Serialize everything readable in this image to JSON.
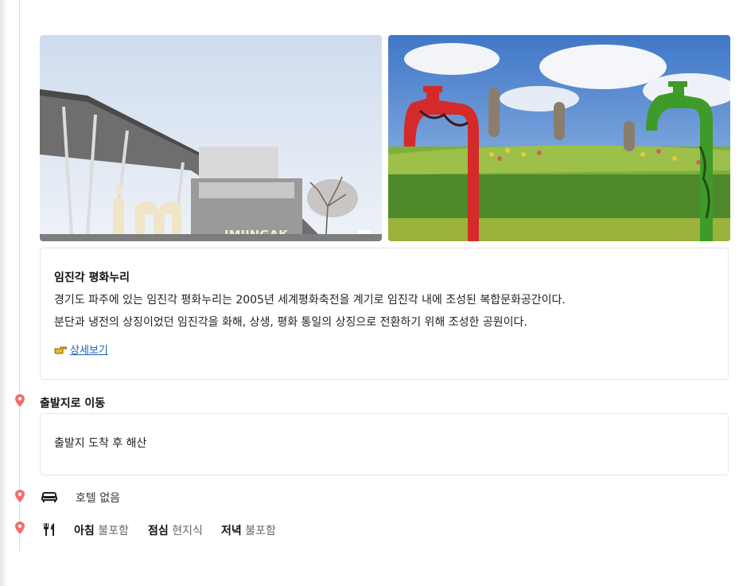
{
  "photos": [
    {
      "alt": "IMJINGAK",
      "sign_text": "IMJINGAK"
    },
    {
      "alt": "faucet-sculptures"
    }
  ],
  "spot": {
    "title": "임진각 평화누리",
    "line1": "경기도 파주에 있는 임진각 평화누리는 2005년 세계평화축전을 계기로 임진각 내에 조성된 복합문화공간이다.",
    "line2": "분단과 냉전의 상징이었던 임진각을 화해, 상생, 평화 통일의 상징으로 전환하기 위해 조성한 공원이다.",
    "more_label": "상세보기"
  },
  "move": {
    "title": "출발지로 이동",
    "note": "출발지 도착 후 해산"
  },
  "hotel": {
    "label": "호텔 없음"
  },
  "meals": [
    {
      "label": "아침",
      "value": "불포함"
    },
    {
      "label": "점심",
      "value": "현지식"
    },
    {
      "label": "저녁",
      "value": "불포함"
    }
  ],
  "colors": {
    "pin": "#f26d6d",
    "link": "#1f5fbf",
    "border": "#e6e6e6"
  },
  "icons": [
    "map-pin-icon",
    "pointing-hand-icon",
    "bed-icon",
    "fork-knife-icon"
  ]
}
